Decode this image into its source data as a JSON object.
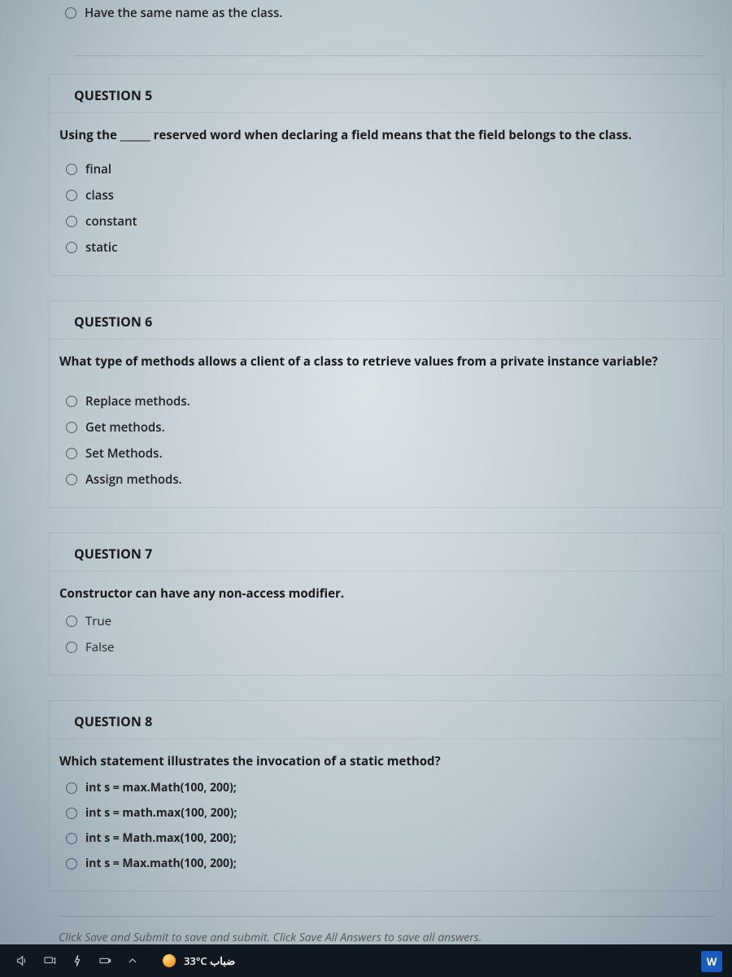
{
  "q4_partial_option": "Have the same name as the class.",
  "questions": [
    {
      "title": "QUESTION 5",
      "prompt": "Using the ______ reserved word when declaring a field means that the field belongs to the class.",
      "options": [
        "final",
        "class",
        "constant",
        "static"
      ]
    },
    {
      "title": "QUESTION 6",
      "prompt": "What type of methods allows a client of a class to retrieve values from a private instance variable?",
      "options": [
        "Replace methods.",
        "Get methods.",
        "Set Methods.",
        "Assign methods."
      ]
    },
    {
      "title": "QUESTION 7",
      "prompt": "Constructor can have any non-access modifier.",
      "options": [
        "True",
        "False"
      ]
    },
    {
      "title": "QUESTION 8",
      "prompt": "Which statement illustrates the invocation of a static method?",
      "options": [
        "int s = max.Math(100, 200);",
        "int s = math.max(100, 200);",
        "int s = Math.max(100, 200);",
        "int s = Max.math(100, 200);"
      ]
    }
  ],
  "instructions": "Click Save and Submit to save and submit. Click Save All Answers to save all answers.",
  "taskbar": {
    "weather": "33°C  ضباب",
    "word_label": "W"
  }
}
